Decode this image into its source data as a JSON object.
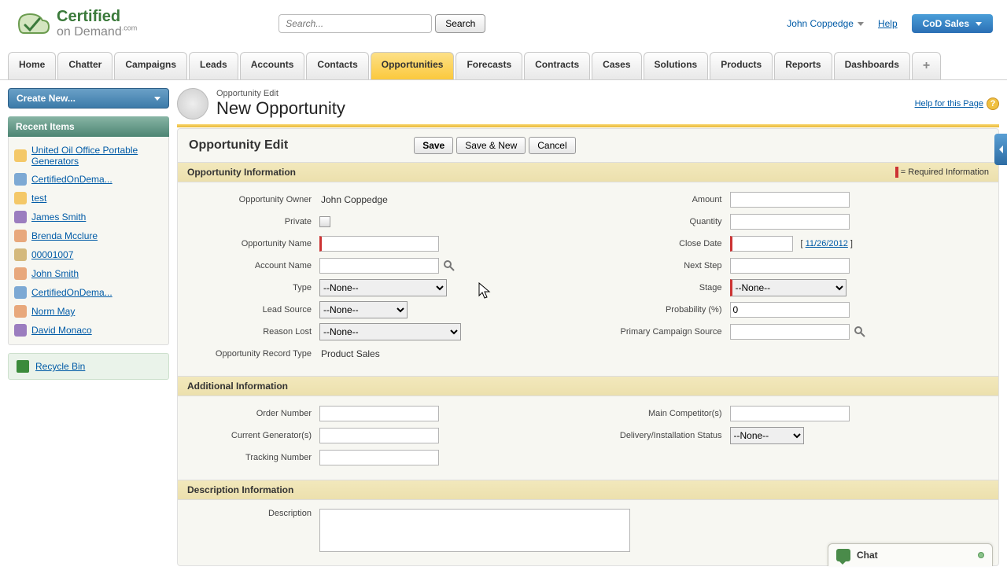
{
  "header": {
    "logo_line1": "Certified",
    "logo_line2": "on Demand",
    "logo_tld": ".com",
    "search_placeholder": "Search...",
    "search_btn": "Search",
    "user": "John Coppedge",
    "help": "Help",
    "app": "CoD Sales"
  },
  "tabs": [
    "Home",
    "Chatter",
    "Campaigns",
    "Leads",
    "Accounts",
    "Contacts",
    "Opportunities",
    "Forecasts",
    "Contracts",
    "Cases",
    "Solutions",
    "Products",
    "Reports",
    "Dashboards"
  ],
  "active_tab": "Opportunities",
  "sidebar": {
    "create_new": "Create New...",
    "recent_hdr": "Recent Items",
    "recent": [
      {
        "label": "United Oil Office Portable Generators",
        "type": "opp"
      },
      {
        "label": "CertifiedOnDema...",
        "type": "acc"
      },
      {
        "label": "test",
        "type": "opp"
      },
      {
        "label": "James Smith",
        "type": "cont"
      },
      {
        "label": "Brenda Mcclure",
        "type": "lead"
      },
      {
        "label": "00001007",
        "type": "case"
      },
      {
        "label": "John Smith",
        "type": "lead"
      },
      {
        "label": "CertifiedOnDema...",
        "type": "acc"
      },
      {
        "label": "Norm May",
        "type": "lead"
      },
      {
        "label": "David Monaco",
        "type": "cont"
      }
    ],
    "recycle": "Recycle Bin"
  },
  "page": {
    "crumb": "Opportunity Edit",
    "title": "New Opportunity",
    "help_link": "Help for this Page"
  },
  "edit": {
    "block_title": "Opportunity Edit",
    "save": "Save",
    "save_new": "Save & New",
    "cancel": "Cancel",
    "sec1": "Opportunity Information",
    "required_note": "= Required Information",
    "labels": {
      "owner": "Opportunity Owner",
      "private": "Private",
      "opp_name": "Opportunity Name",
      "account": "Account Name",
      "type": "Type",
      "lead_source": "Lead Source",
      "reason_lost": "Reason Lost",
      "record_type": "Opportunity Record Type",
      "amount": "Amount",
      "quantity": "Quantity",
      "close_date": "Close Date",
      "next_step": "Next Step",
      "stage": "Stage",
      "probability": "Probability (%)",
      "campaign": "Primary Campaign Source",
      "order_no": "Order Number",
      "curr_gen": "Current Generator(s)",
      "tracking": "Tracking Number",
      "competitor": "Main Competitor(s)",
      "delivery": "Delivery/Installation Status",
      "description": "Description"
    },
    "values": {
      "owner": "John Coppedge",
      "record_type": "Product Sales",
      "probability": "0",
      "close_date_hint": "11/26/2012",
      "none": "--None--"
    },
    "sec2": "Additional Information",
    "sec3": "Description Information"
  },
  "chat": {
    "label": "Chat"
  }
}
